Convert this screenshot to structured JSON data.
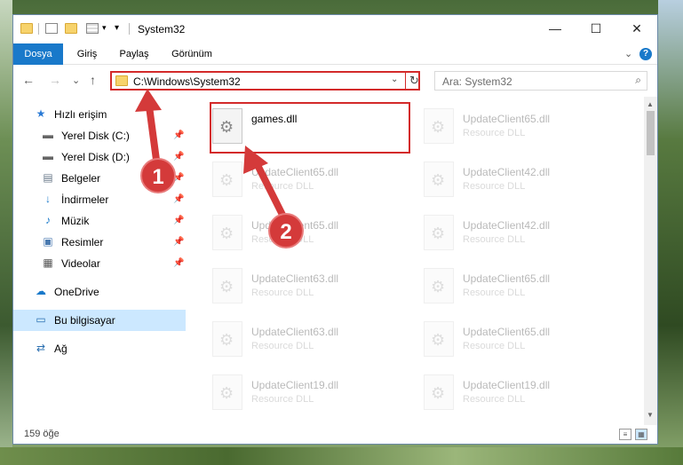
{
  "window": {
    "title": "System32",
    "controls": {
      "minimize": "—",
      "maximize": "☐",
      "close": "✕"
    }
  },
  "ribbon": {
    "tabs": [
      "Dosya",
      "Giriş",
      "Paylaş",
      "Görünüm"
    ],
    "expand": "⌄",
    "help": "?"
  },
  "nav": {
    "back": "←",
    "forward": "→",
    "recent": "⌄",
    "up": "↑",
    "address": "C:\\Windows\\System32",
    "address_drop": "⌄",
    "refresh": "↻",
    "search_placeholder": "Ara: System32",
    "search_icon": "⌕"
  },
  "sidebar": {
    "items": [
      {
        "label": "Hızlı erişim",
        "icon": "star-icon",
        "glyph": "★",
        "pinned": false
      },
      {
        "label": "Yerel Disk (C:)",
        "icon": "drive-icon",
        "glyph": "▬",
        "pinned": true
      },
      {
        "label": "Yerel Disk (D:)",
        "icon": "drive-icon",
        "glyph": "▬",
        "pinned": true
      },
      {
        "label": "Belgeler",
        "icon": "documents-icon",
        "glyph": "▤",
        "pinned": true
      },
      {
        "label": "İndirmeler",
        "icon": "download-icon",
        "glyph": "↓",
        "pinned": true
      },
      {
        "label": "Müzik",
        "icon": "music-icon",
        "glyph": "♪",
        "pinned": true
      },
      {
        "label": "Resimler",
        "icon": "pictures-icon",
        "glyph": "▣",
        "pinned": true
      },
      {
        "label": "Videolar",
        "icon": "videos-icon",
        "glyph": "▦",
        "pinned": true
      },
      {
        "label": "OneDrive",
        "icon": "cloud-icon",
        "glyph": "☁",
        "pinned": false
      },
      {
        "label": "Bu bilgisayar",
        "icon": "computer-icon",
        "glyph": "▭",
        "pinned": false
      },
      {
        "label": "Ağ",
        "icon": "network-icon",
        "glyph": "⇄",
        "pinned": false
      }
    ],
    "pin_glyph": "📌"
  },
  "files": [
    {
      "name": "games.dll",
      "type": ""
    },
    {
      "name": "UpdateClient65.dll",
      "type": "Resource DLL"
    },
    {
      "name": "UpdateClient65.dll",
      "type": "Resource DLL"
    },
    {
      "name": "UpdateClient42.dll",
      "type": "Resource DLL"
    },
    {
      "name": "UpdateClient65.dll",
      "type": "Resource DLL"
    },
    {
      "name": "UpdateClient42.dll",
      "type": "Resource DLL"
    },
    {
      "name": "UpdateClient63.dll",
      "type": "Resource DLL"
    },
    {
      "name": "UpdateClient65.dll",
      "type": "Resource DLL"
    },
    {
      "name": "UpdateClient63.dll",
      "type": "Resource DLL"
    },
    {
      "name": "UpdateClient65.dll",
      "type": "Resource DLL"
    },
    {
      "name": "UpdateClient19.dll",
      "type": "Resource DLL"
    },
    {
      "name": "UpdateClient19.dll",
      "type": "Resource DLL"
    }
  ],
  "status": {
    "count": "159 öğe"
  },
  "callouts": [
    "1",
    "2"
  ],
  "colors": {
    "accent": "#1979ca",
    "highlight": "#d32a2a",
    "selected": "#cce8ff"
  }
}
